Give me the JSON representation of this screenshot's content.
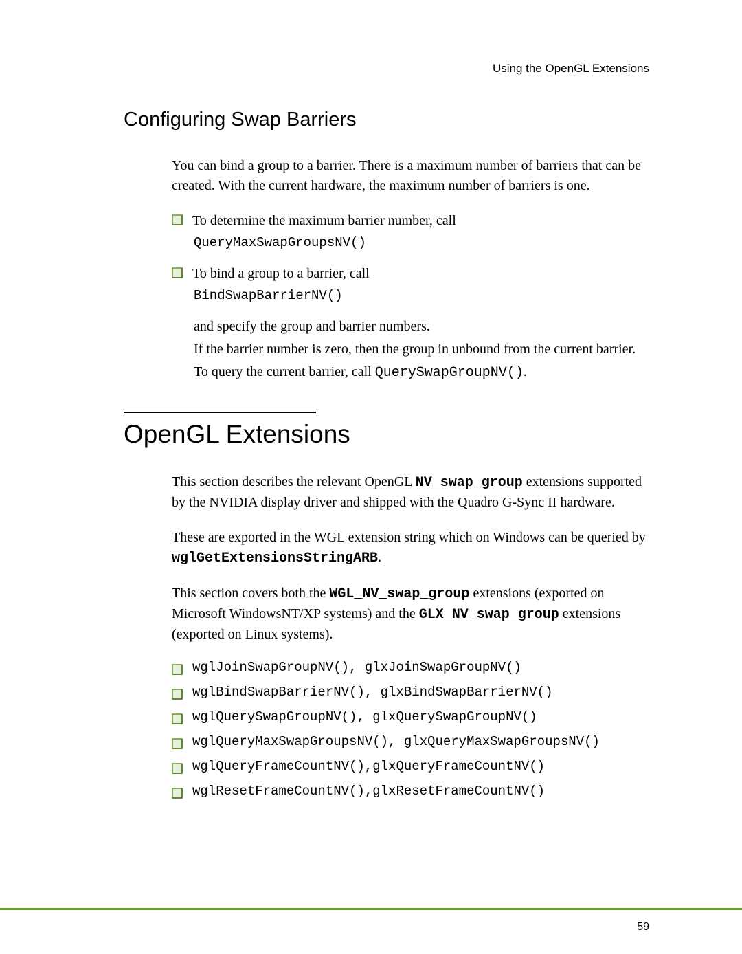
{
  "header": {
    "title": "Using the OpenGL Extensions"
  },
  "section1": {
    "heading": "Configuring Swap Barriers",
    "intro": "You can bind a group to a barrier. There is a maximum number of barriers that can be created. With the current hardware, the maximum number of barriers is one.",
    "bullets": [
      {
        "text": "To determine the maximum barrier number, call",
        "code": "QueryMaxSwapGroupsNV()"
      },
      {
        "text": "To bind a group to a barrier, call",
        "code": "BindSwapBarrierNV()"
      }
    ],
    "after1": "and specify the group and barrier numbers.",
    "after2": "If the barrier number is zero, then the group in unbound from the current barrier.",
    "after3_pre": "To query the current barrier, call ",
    "after3_code": "QuerySwapGroupNV()",
    "after3_post": "."
  },
  "section2": {
    "heading": "OpenGL Extensions",
    "p1_a": "This section describes the relevant OpenGL ",
    "p1_code": "NV_swap_group",
    "p1_b": " extensions supported by the NVIDIA display driver and shipped with the Quadro G-Sync II hardware.",
    "p2_a": "These are exported in the WGL extension string which on Windows can be queried by ",
    "p2_code": "wglGetExtensionsStringARB",
    "p2_b": ".",
    "p3_a": "This section covers both the ",
    "p3_code1": "WGL_NV_swap_group",
    "p3_b": " extensions (exported on Microsoft WindowsNT/XP systems) and the ",
    "p3_code2": "GLX_NV_swap_group",
    "p3_c": " extensions (exported on Linux systems).",
    "ext_list": [
      "wglJoinSwapGroupNV(), glxJoinSwapGroupNV()",
      "wglBindSwapBarrierNV(), glxBindSwapBarrierNV()",
      "wglQuerySwapGroupNV(), glxQuerySwapGroupNV()",
      "wglQueryMaxSwapGroupsNV(), glxQueryMaxSwapGroupsNV()",
      "wglQueryFrameCountNV(),glxQueryFrameCountNV()",
      "wglResetFrameCountNV(),glxResetFrameCountNV()"
    ]
  },
  "footer": {
    "page_num": "59"
  },
  "colors": {
    "bullet_stroke": "#5b8f1a",
    "bullet_fill": "#e6efda",
    "rule": "#66a31f"
  }
}
